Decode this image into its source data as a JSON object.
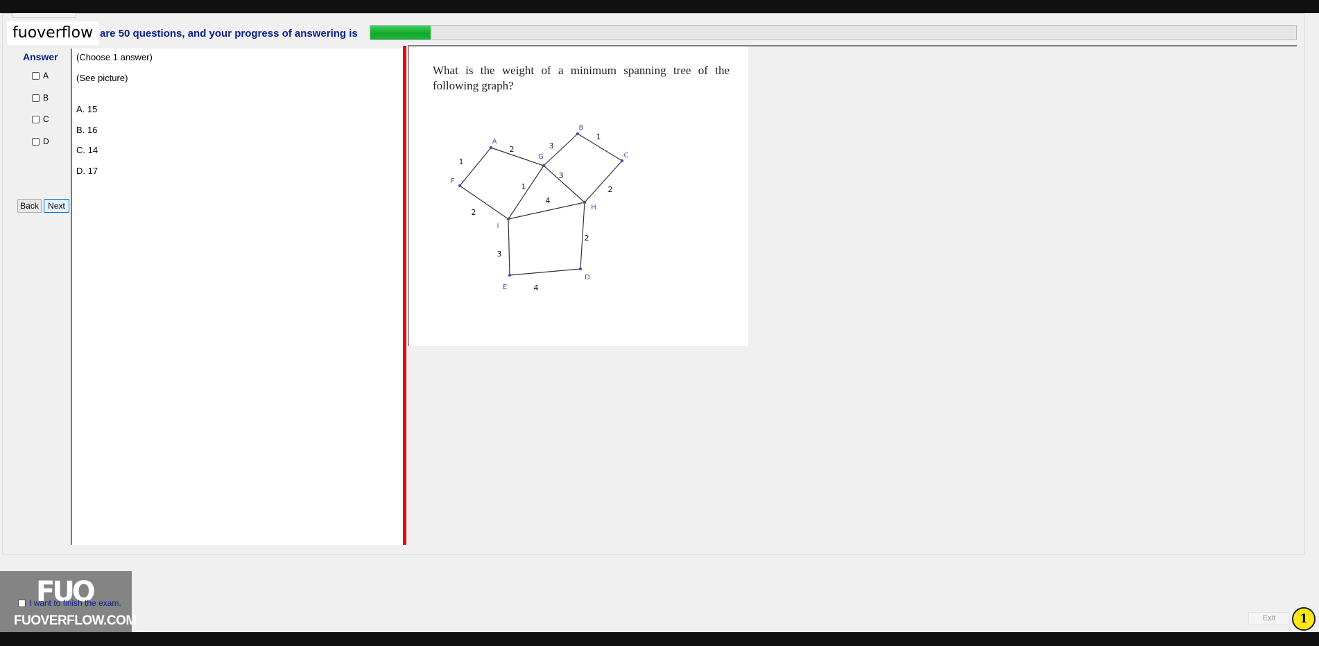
{
  "header": {
    "site_label": "fuoverflow",
    "progress_text": "are 50 questions, and your progress of answering is",
    "progress_fraction": 0.065
  },
  "answer_panel": {
    "heading": "Answer",
    "options": [
      {
        "label": "A",
        "checked": false
      },
      {
        "label": "B",
        "checked": false
      },
      {
        "label": "C",
        "checked": false
      },
      {
        "label": "D",
        "checked": false
      }
    ],
    "back_label": "Back",
    "next_label": "Next"
  },
  "question": {
    "instruction": "(Choose 1 answer)",
    "note": "(See picture)",
    "choices": [
      "A.  15",
      "B.  16",
      "C.  14",
      "D.  17"
    ]
  },
  "image": {
    "question_text": "What is the weight of a minimum spanning tree of the following graph?",
    "graph": {
      "vertices": [
        "A",
        "B",
        "C",
        "D",
        "E",
        "F",
        "G",
        "H",
        "I"
      ],
      "edges": [
        {
          "from": "F",
          "to": "A",
          "weight": "1"
        },
        {
          "from": "A",
          "to": "G",
          "weight": "2"
        },
        {
          "from": "G",
          "to": "B",
          "weight": "3"
        },
        {
          "from": "B",
          "to": "C",
          "weight": "1"
        },
        {
          "from": "G",
          "to": "H",
          "weight": "3"
        },
        {
          "from": "G",
          "to": "I",
          "weight": "1"
        },
        {
          "from": "I",
          "to": "H",
          "weight": "4"
        },
        {
          "from": "C",
          "to": "H",
          "weight": "2"
        },
        {
          "from": "F",
          "to": "I",
          "weight": "2"
        },
        {
          "from": "I",
          "to": "E",
          "weight": "3"
        },
        {
          "from": "H",
          "to": "D",
          "weight": "2"
        },
        {
          "from": "E",
          "to": "D",
          "weight": "4"
        }
      ],
      "vertex_color": "#4a4ab4",
      "edge_color": "#333333"
    }
  },
  "footer": {
    "finish_label": "I want to finish the exam.",
    "exit_label": "Exit",
    "badge": "1"
  },
  "watermark": {
    "logo": "FUO",
    "text": "FUOVERFLOW.COM"
  },
  "colors": {
    "accent_blue": "#0b1f8e",
    "progress_green": "#1fb43a",
    "splitter_red": "#e10e0e"
  }
}
